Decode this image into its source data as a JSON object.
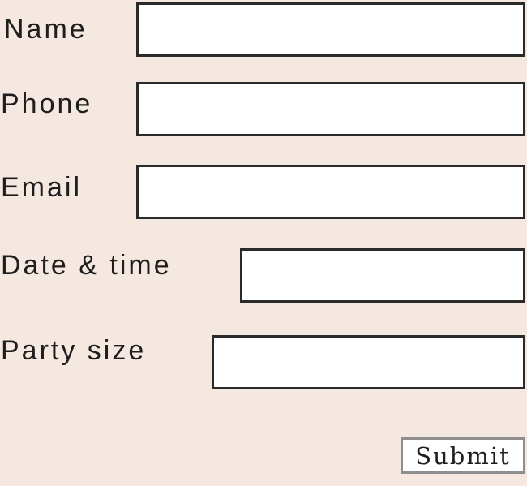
{
  "form": {
    "fields": [
      {
        "label": "Name",
        "value": ""
      },
      {
        "label": "Phone",
        "value": ""
      },
      {
        "label": "Email",
        "value": ""
      },
      {
        "label": "Date & time",
        "value": ""
      },
      {
        "label": "Party size",
        "value": ""
      }
    ],
    "submit_label": "Submit"
  }
}
